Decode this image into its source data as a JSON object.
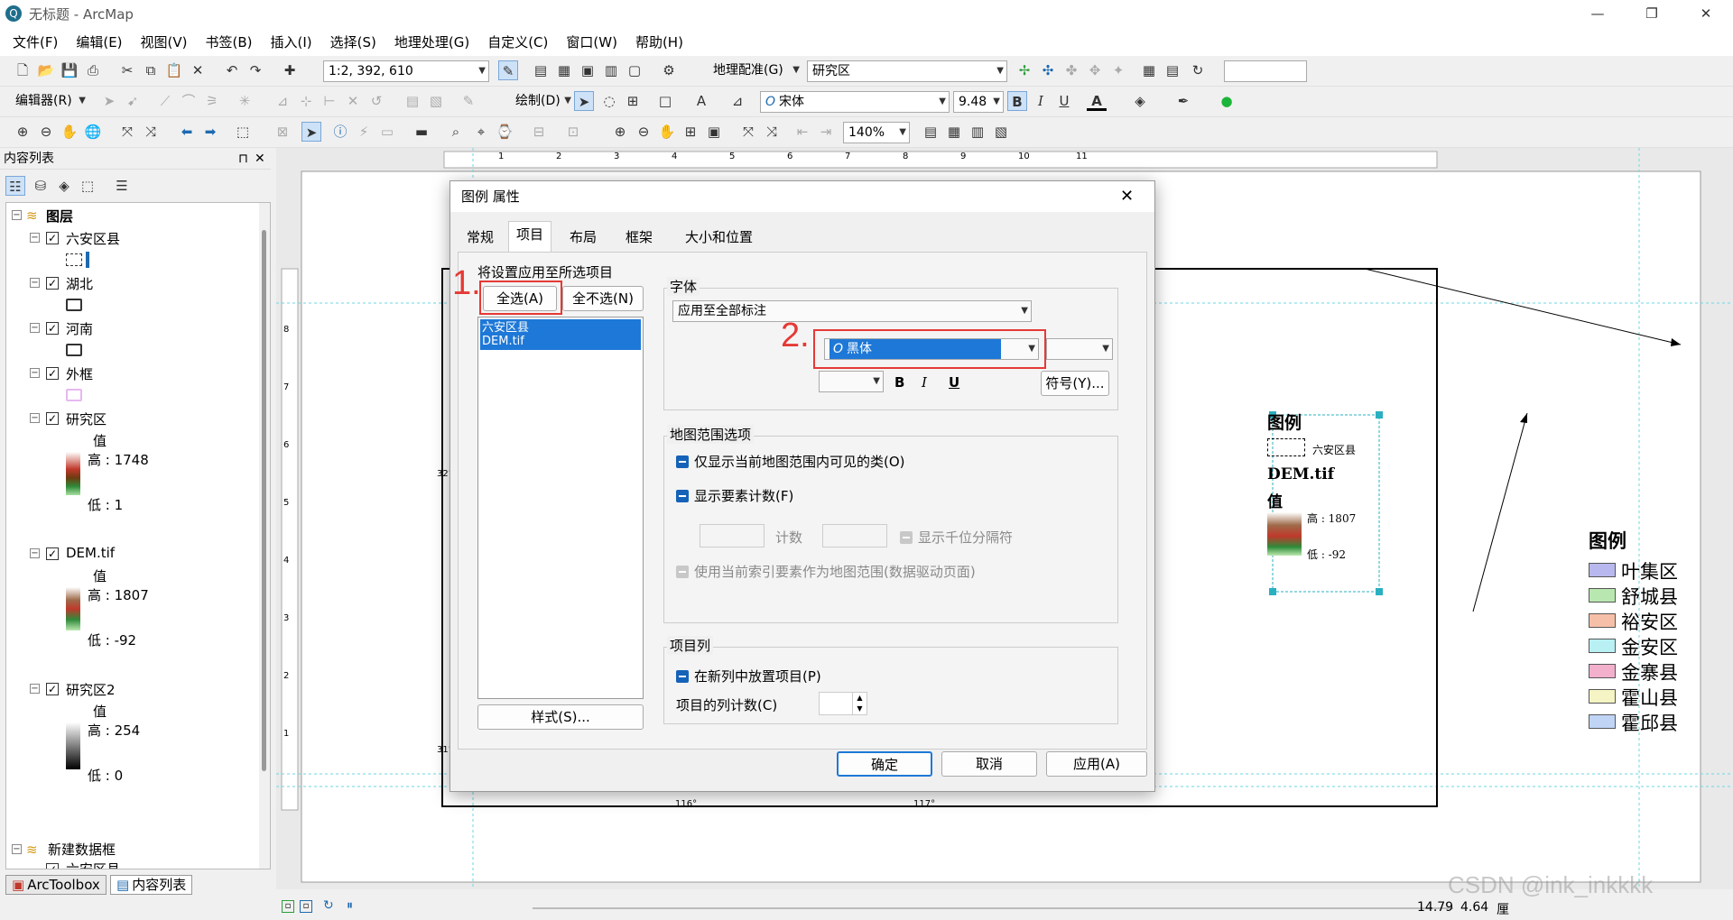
{
  "window": {
    "title": "无标题 - ArcMap",
    "app_icon": "globe-icon"
  },
  "menu": [
    "文件(F)",
    "编辑(E)",
    "视图(V)",
    "书签(B)",
    "插入(I)",
    "选择(S)",
    "地理处理(G)",
    "自定义(C)",
    "窗口(W)",
    "帮助(H)"
  ],
  "toolbar": {
    "scale": "1:2, 392, 610",
    "georef_label": "地理配准(G)",
    "georef_layer": "研究区",
    "editor_label": "编辑器(R)",
    "draw_label": "绘制(D)",
    "font_name": "宋体",
    "font_size": "9.48",
    "zoom": "140%"
  },
  "toc": {
    "header": "内容列表",
    "pin": "⊓",
    "close": "✕",
    "root": "图层",
    "layers": [
      {
        "name": "六安区县",
        "symbol": "dashed"
      },
      {
        "name": "湖北",
        "symbol": "rect"
      },
      {
        "name": "河南",
        "symbol": "rect"
      },
      {
        "name": "外框",
        "symbol": "pinkrect"
      },
      {
        "name": "研究区",
        "value_label": "值",
        "high": "高 : 1748",
        "low": "低 : 1"
      },
      {
        "name": "DEM.tif",
        "value_label": "值",
        "high": "高 : 1807",
        "low": "低 : -92"
      },
      {
        "name": "研究区2",
        "value_label": "值",
        "high": "高 : 254",
        "low": "低 : 0"
      }
    ],
    "new_frame": "新建数据框",
    "new_frame_child": "六安区县"
  },
  "bottom_tabs": [
    "ArcToolbox",
    "内容列表"
  ],
  "dialog": {
    "title": "图例 属性",
    "tabs": [
      "常规",
      "项目",
      "布局",
      "框架",
      "大小和位置"
    ],
    "active_tab": "项目",
    "apply_label": "将设置应用至所选项目",
    "select_all": "全选(A)",
    "select_none": "全不选(N)",
    "items": [
      "六安区县",
      "DEM.tif"
    ],
    "style_btn": "样式(S)...",
    "font_group": "字体",
    "apply_to": "应用至全部标注",
    "font_name": "黑体",
    "symbol_btn": "符号(Y)...",
    "bold": "B",
    "italic": "I",
    "underline": "U",
    "map_extent_group": "地图范围选项",
    "opt_visible": "仅显示当前地图范围内可见的类(O)",
    "opt_count": "显示要素计数(F)",
    "count_label": "计数",
    "thousands": "显示千位分隔符",
    "opt_index": "使用当前索引要素作为地图范围(数据驱动页面)",
    "columns_group": "项目列",
    "opt_newcol": "在新列中放置项目(P)",
    "col_count_label": "项目的列计数(C)",
    "ok": "确定",
    "cancel": "取消",
    "apply": "应用(A)",
    "close": "✕"
  },
  "annotations": {
    "step1": "1.",
    "step2": "2.",
    "accent": "#e53935"
  },
  "layout": {
    "legend1": {
      "title": "图例",
      "item1": "六安区县",
      "dem": "DEM.tif",
      "value": "值",
      "high": "高 : 1807",
      "low": "低 : -92"
    },
    "legend2": {
      "title": "图例",
      "items": [
        {
          "name": "叶集区",
          "color": "#b8b8ee"
        },
        {
          "name": "舒城县",
          "color": "#b8e8b0"
        },
        {
          "name": "裕安区",
          "color": "#f6c0a8"
        },
        {
          "name": "金安区",
          "color": "#b8f0f4"
        },
        {
          "name": "金寨县",
          "color": "#f2b0cc"
        },
        {
          "name": "霍山县",
          "color": "#f4f4c4"
        },
        {
          "name": "霍邱县",
          "color": "#c0d4f6"
        }
      ]
    },
    "lon1": "116°",
    "lon2": "117°",
    "lat1": "32°",
    "lat2": "31°",
    "top_ruler": [
      "1",
      "2",
      "3",
      "4",
      "5",
      "6",
      "7",
      "8",
      "9",
      "10",
      "11"
    ],
    "left_ruler": [
      "8",
      "7",
      "6",
      "5",
      "4",
      "3",
      "2",
      "1"
    ]
  },
  "status": {
    "x": "14.79",
    "y": "4.64",
    "unit": "厘"
  },
  "watermark": "CSDN @ink_inkkkk"
}
